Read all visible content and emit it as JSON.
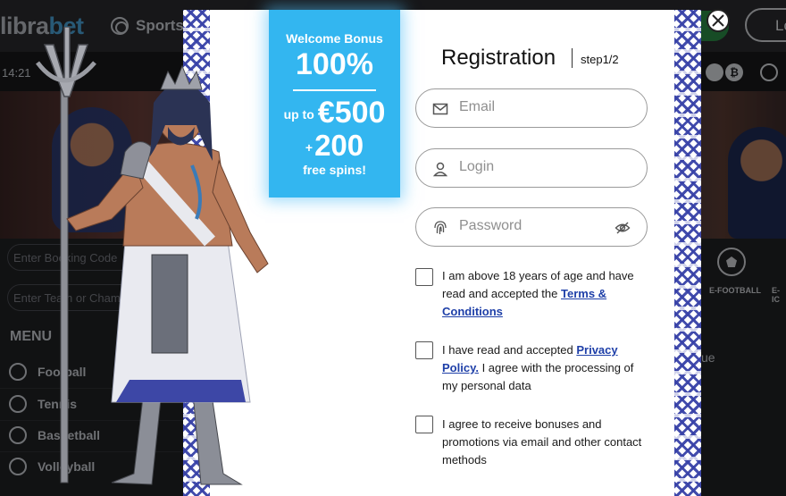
{
  "site": {
    "logo_left": "libra",
    "logo_right": "bet",
    "nav_sports": "Sports",
    "login_btn": "Lo",
    "clock": "14:21",
    "bonus_code_placeholder": "Enter Booking Code",
    "team_placeholder": "Enter Team or Cham",
    "menu_title": "MENU",
    "menu_items": [
      "Football",
      "Tennis",
      "Basketball",
      "Volleyball"
    ],
    "efootball_label": "E-FOOTBALL",
    "e_label2": "E-IC",
    "ue_text": "ue",
    "coin_label": "₿"
  },
  "bonus": {
    "line1": "Welcome Bonus",
    "line2": "100%",
    "line3_prefix": "up to",
    "line3_value": "€500",
    "line4_prefix": "+",
    "line4_value": "200",
    "line5": "free spins!"
  },
  "registration": {
    "title": "Registration",
    "step": "step1/2",
    "email_placeholder": "Email",
    "login_placeholder": "Login",
    "password_placeholder": "Password",
    "check1_text": "I am above 18 years of age and have read and accepted the",
    "check1_link": "Terms & Conditions",
    "check2_text_a": "I have read and accepted",
    "check2_link": "Privacy Policy.",
    "check2_text_b": "I agree with the processing of my personal data",
    "check3_text": "I agree to receive bonuses and promotions via email and other contact methods"
  },
  "colors": {
    "accent_blue": "#33b6f0",
    "link_blue": "#1e3fa8",
    "meander_blue": "#3842a8"
  },
  "icons": {
    "close": "close-icon",
    "email": "envelope-icon",
    "login": "user-icon",
    "password": "fingerprint-icon",
    "visibility": "eye-off-icon"
  }
}
